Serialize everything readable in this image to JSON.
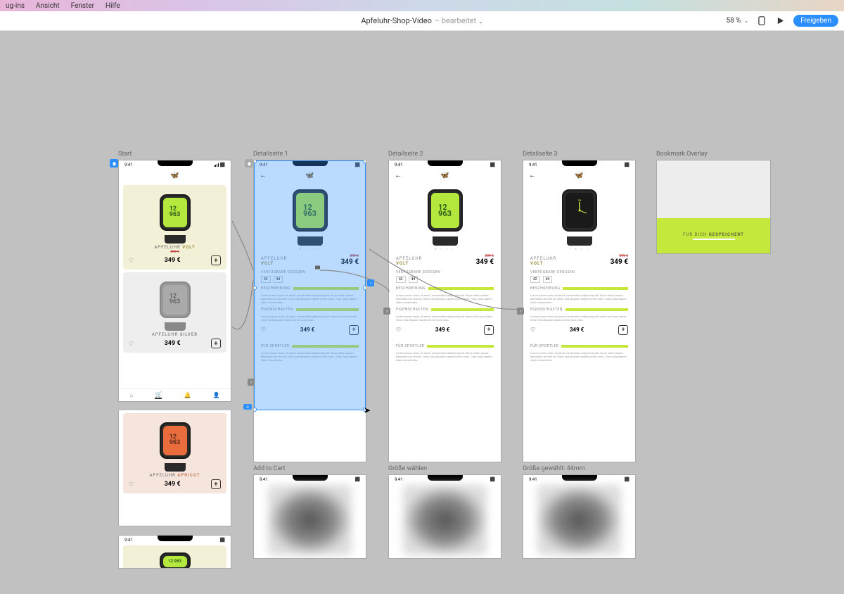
{
  "menubar": {
    "items": [
      "ug-ins",
      "Ansicht",
      "Fenster",
      "Hilfe"
    ]
  },
  "toolbar": {
    "doc_title": "Apfeluhr-Shop-Video",
    "doc_status": "– bearbeitet",
    "zoom": "58 %",
    "share": "Freigeben"
  },
  "artboards": {
    "start": {
      "label": "Start",
      "time": "9:41",
      "products": [
        {
          "name_pre": "APFELUHR",
          "name_var": "VOLT",
          "old": "399 €",
          "price": "349 €",
          "face": "green"
        },
        {
          "name_pre": "APFELUHR",
          "name_var": "SILVER",
          "price": "349 €",
          "face": "grey"
        },
        {
          "name_pre": "APFELUHR",
          "name_var": "APRICOT",
          "price": "349 €",
          "face": "orange"
        }
      ]
    },
    "detail1": {
      "label": "Detailseite 1",
      "time": "9:41",
      "name_pre": "APFELUHR",
      "name_var": "VOLT",
      "old": "399 €",
      "price": "349 €",
      "sizes_label": "VERFÜGBARE GRÖSSEN",
      "sizes": [
        "42",
        "44"
      ],
      "sec1": "BESCHREIBUNG",
      "sec2": "EIGENSCHAFTEN",
      "sec3": "FÜR SPORTLER",
      "face": "green"
    },
    "detail2": {
      "label": "Detailseite 2",
      "time": "9:41",
      "name_pre": "APFELUHR",
      "name_var": "VOLT",
      "old": "399 €",
      "price": "349 €",
      "sizes_label": "VERFÜGBARE GRÖSSEN",
      "sizes": [
        "42",
        "44"
      ],
      "sec1": "BESCHREIBUNG",
      "sec2": "EIGENSCHAFTEN",
      "sec3": "FÜR SPORTLER",
      "face": "green"
    },
    "detail3": {
      "label": "Detailseite 3",
      "time": "9:41",
      "name_pre": "APFELUHR",
      "name_var": "VOLT",
      "old": "399 €",
      "price": "349 €",
      "sizes_label": "VERFÜGBARE GRÖSSEN",
      "sizes": [
        "42",
        "44"
      ],
      "sec1": "BESCHREIBUNG",
      "sec2": "EIGENSCHAFTEN",
      "sec3": "FÜR SPORTLER",
      "face": "analog"
    },
    "overlay": {
      "label": "Bookmark Overlay",
      "text_pre": "FÜR DICH",
      "text_bold": "GESPEICHERT"
    },
    "addcart": {
      "label": "Add to Cart",
      "time": "9:41"
    },
    "sizesel": {
      "label": "Größe wählen",
      "time": "9:41"
    },
    "sizepicked": {
      "label": "Größe gewählt: 44mm",
      "time": "9:41"
    }
  },
  "lorem": "Lorem ipsum dolor sit amet, consectetur adipiscing elit. Nunc nulla massa bibendum ac erat sit. Dolor sed aliquam sapien lorem nunc. Cras nulla sapien vitae consectetur.",
  "lorem_sm": "Lorem ipsum dolor sit amet, consectetur adipiscing elit donec vel nunc lorem. Dolor sed aliquam sapien lorem nunc cras.",
  "watch_digits": "12\n963"
}
